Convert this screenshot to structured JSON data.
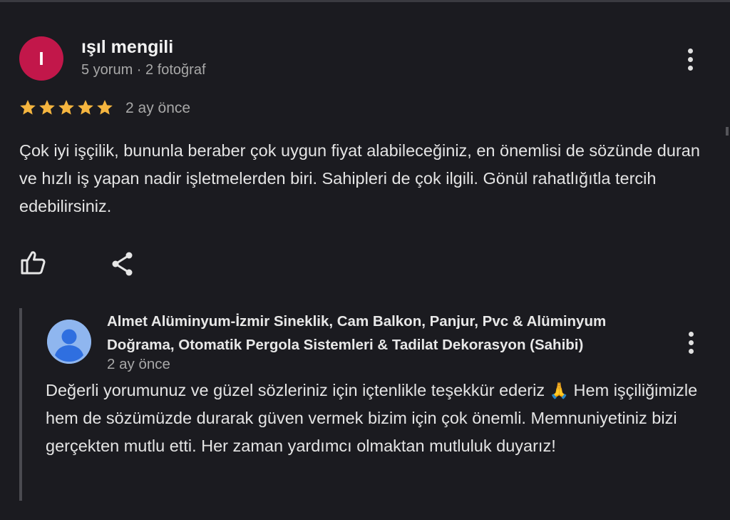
{
  "review": {
    "author_initial": "I",
    "author_name": "ışıl mengili",
    "author_meta": "5 yorum · 2 fotoğraf",
    "rating": 5,
    "time_ago": "2 ay önce",
    "text": "Çok iyi işçilik, bununla beraber çok uygun fiyat alabileceğiniz, en önemlisi de sözünde duran ve hızlı iş yapan nadir işletmelerden biri. Sahipleri de çok ilgili. Gönül rahatlığıtla tercih edebilirsiniz."
  },
  "reply": {
    "owner_name": "Almet Alüminyum-İzmir Sineklik, Cam Balkon, Panjur, Pvc & Alüminyum Doğrama, Otomatik Pergola Sistemleri & Tadilat Dekorasyon (Sahibi)",
    "time_ago": "2 ay önce",
    "text": "Değerli yorumunuz ve güzel sözleriniz için içtenlikle teşekkür ederiz",
    "emoji": "🙏",
    "text_rest": "Hem işçiliğimizle hem de sözümüzde durarak güven vermek bizim için çok önemli. Memnuniyetiniz bizi gerçekten mutlu etti. Her zaman yardımcı olmaktan mutluluk duyarız!"
  },
  "icons": {
    "more": "more-vert-icon",
    "like": "thumb-up-icon",
    "share": "share-icon",
    "star": "star-icon"
  },
  "colors": {
    "background": "#1b1b20",
    "star": "#f5b53f",
    "avatar": "#c2174a",
    "owner_avatar": "#8fb6ef"
  }
}
